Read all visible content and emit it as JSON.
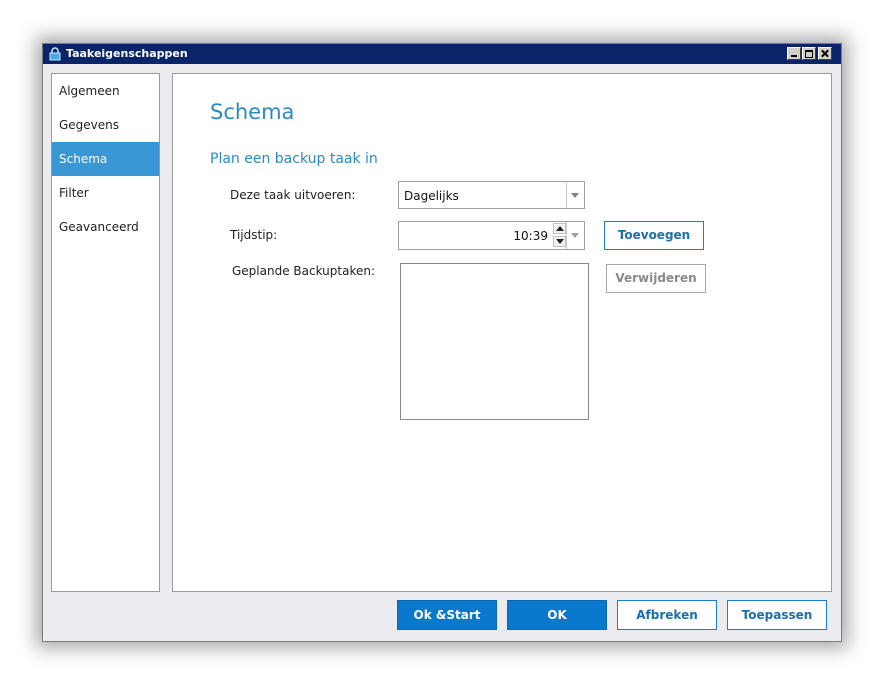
{
  "window": {
    "title": "Taakeigenschappen"
  },
  "sidebar": {
    "items": [
      {
        "label": "Algemeen"
      },
      {
        "label": "Gegevens"
      },
      {
        "label": "Schema",
        "selected": true
      },
      {
        "label": "Filter"
      },
      {
        "label": "Geavanceerd"
      }
    ]
  },
  "main": {
    "title": "Schema",
    "section_title": "Plan een backup taak in",
    "run_label": "Deze taak uitvoeren:",
    "run_value": "Dagelijks",
    "time_label": "Tijdstip:",
    "time_value": "10:39",
    "scheduled_label": "Geplande Backuptaken:",
    "add_button": "Toevoegen",
    "remove_button": "Verwijderen"
  },
  "footer": {
    "ok_start": "Ok &Start",
    "ok": "OK",
    "cancel": "Afbreken",
    "apply": "Toepassen"
  },
  "colors": {
    "accent": "#3a96d4",
    "title_blue": "#2a8ac8",
    "primary_button": "#0a78cc",
    "titlebar": "#0a246a"
  }
}
